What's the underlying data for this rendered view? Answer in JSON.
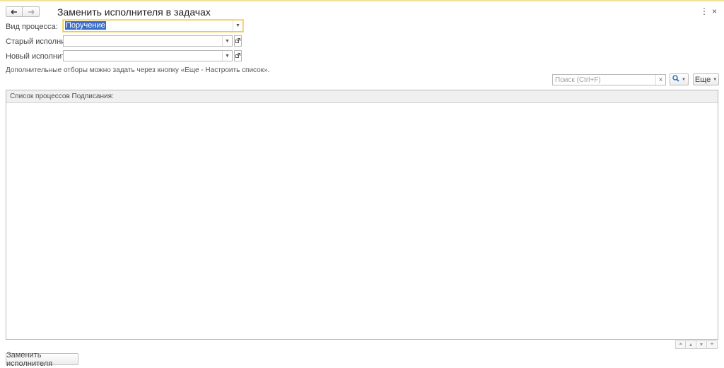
{
  "window": {
    "title": "Заменить исполнителя в задачах",
    "menu_icon": "⋮",
    "close_icon": "×"
  },
  "nav": {
    "back_icon": "🡐",
    "forward_icon": "🡒"
  },
  "form": {
    "process_type": {
      "label": "Вид процесса:",
      "value": "Поручение"
    },
    "old_performer": {
      "label": "Старый исполнитель:",
      "value": ""
    },
    "new_performer": {
      "label": "Новый исполнитель:",
      "value": ""
    },
    "hint": "Дополнительные отборы можно задать через кнопку «Еще - Настроить список»."
  },
  "toolbar": {
    "search_placeholder": "Поиск (Ctrl+F)",
    "search_clear": "×",
    "search_button_icon": "magnifier",
    "more_label": "Еще"
  },
  "list": {
    "header": "Список процессов Подписания:",
    "rows": []
  },
  "footer": {
    "replace_label": "Заменить исполнителя"
  },
  "colors": {
    "focus_border": "#f2c64b",
    "selection": "#3b6cc8",
    "top_line": "#f2e39a"
  }
}
